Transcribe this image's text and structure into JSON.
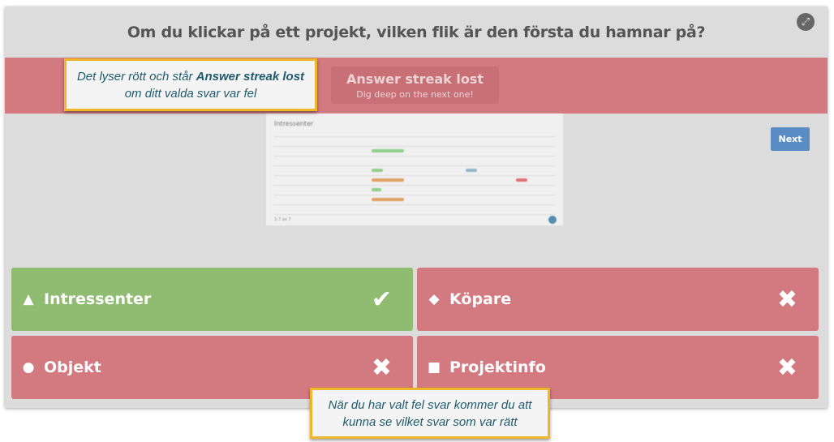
{
  "question": "Om du klickar på ett projekt, vilken flik är den första du hamnar på?",
  "banner": {
    "title": "Answer streak lost",
    "subtitle": "Dig deep on the next one!",
    "color": "#d37a80"
  },
  "callouts": {
    "top": {
      "prefix": "Det lyser rött och står ",
      "bold": "Answer streak lost",
      "suffix": "om ditt valda svar var fel"
    },
    "bottom": {
      "text": "När du har valt fel svar kommer du att kunna se vilket svar som var rätt"
    }
  },
  "preview": {
    "title": "Intressenter",
    "pagination": "1-7 av 7"
  },
  "next_label": "Next",
  "answers": [
    {
      "label": "Intressenter",
      "shape": "triangle-icon",
      "correct": true,
      "color": "#8fbc71"
    },
    {
      "label": "Köpare",
      "shape": "diamond-icon",
      "correct": false,
      "color": "#d37a80"
    },
    {
      "label": "Objekt",
      "shape": "circle-icon",
      "correct": false,
      "color": "#d37a80"
    },
    {
      "label": "Projektinfo",
      "shape": "square-icon",
      "correct": false,
      "color": "#d37a80"
    }
  ]
}
